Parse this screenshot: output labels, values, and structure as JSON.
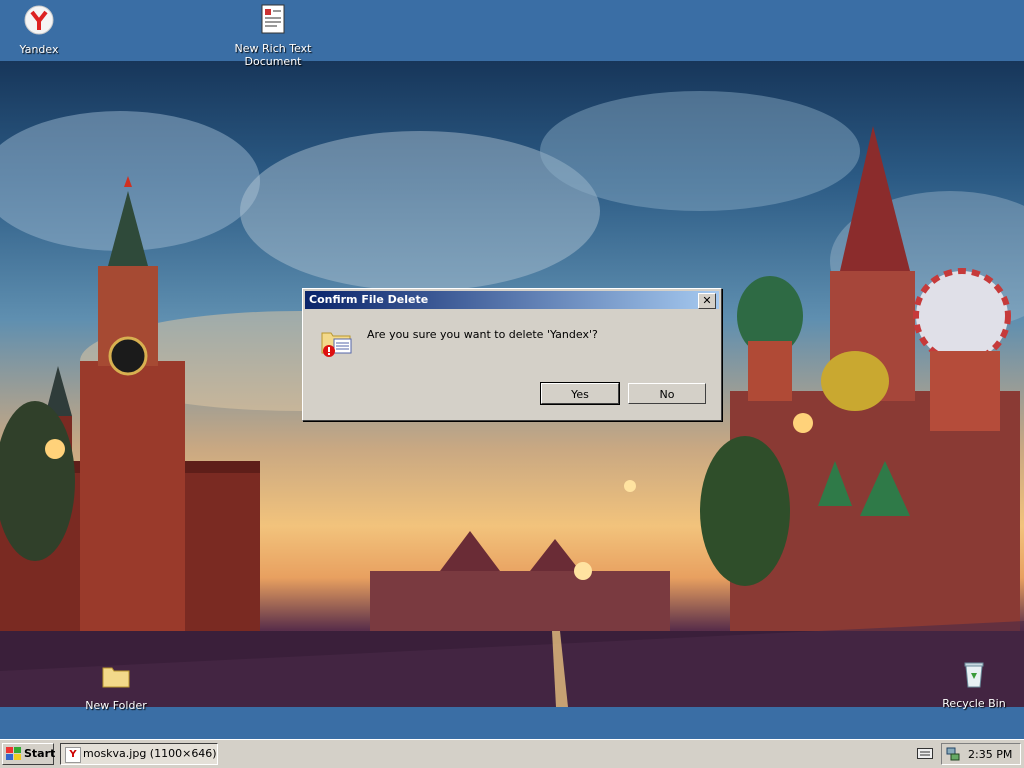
{
  "desktop": {
    "icons": [
      {
        "label": "Yandex"
      },
      {
        "label": "New Rich Text Document"
      },
      {
        "label": "New Folder"
      },
      {
        "label": "Recycle Bin"
      }
    ]
  },
  "dialog": {
    "title": "Confirm File Delete",
    "message": "Are you sure you want to delete 'Yandex'?",
    "yes_label": "Yes",
    "no_label": "No",
    "close_label": "✕",
    "icon": "folder-delete-warning-icon"
  },
  "taskbar": {
    "start_label": "Start",
    "window_button_label": "moskva.jpg (1100×646) ...",
    "clock": "2:35 PM"
  },
  "colors": {
    "desktop": "#3a6ea5",
    "titlebar_start": "#0a246a",
    "titlebar_end": "#a6caf0",
    "face": "#d4d0c8"
  }
}
